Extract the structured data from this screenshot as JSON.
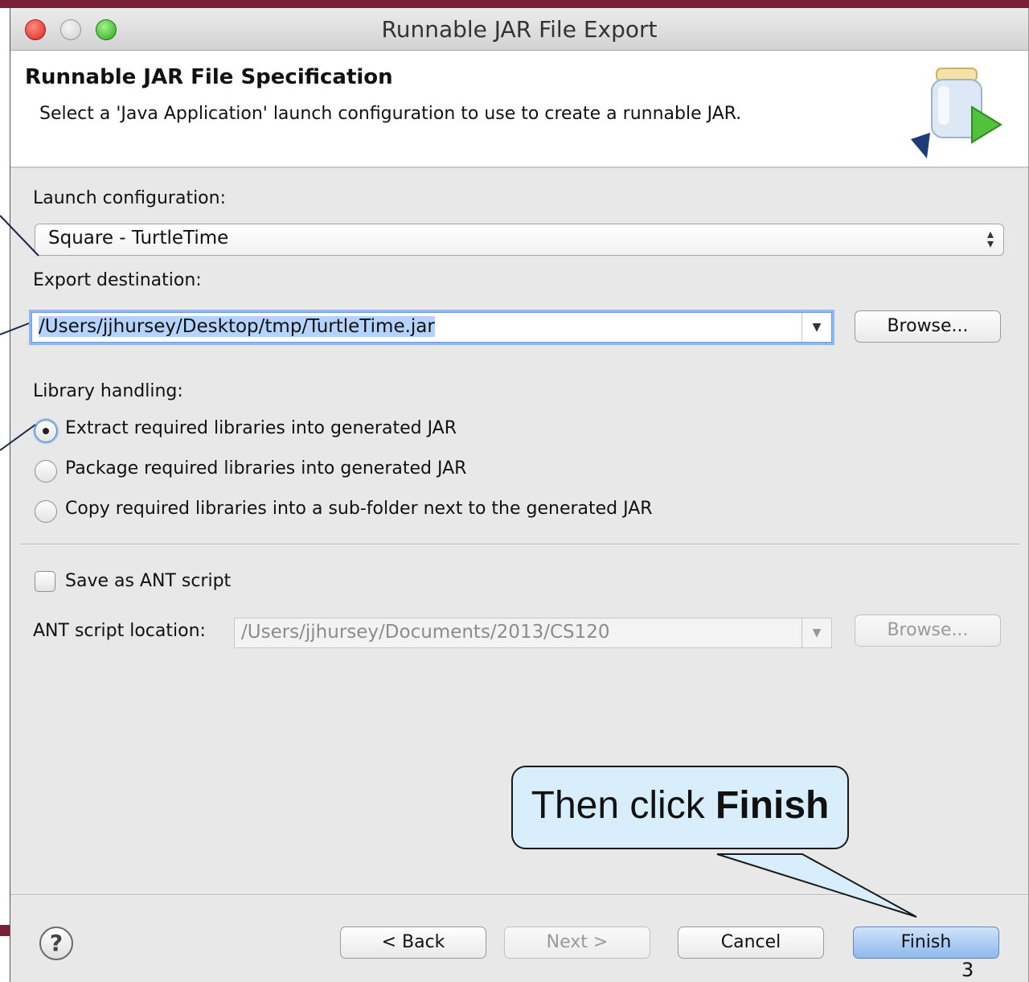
{
  "window": {
    "title": "Runnable JAR File Export"
  },
  "header": {
    "title": "Runnable JAR File Specification",
    "description": "Select a 'Java Application' launch configuration to use to create a runnable JAR."
  },
  "launch": {
    "label": "Launch configuration:",
    "selected": "Square - TurtleTime"
  },
  "export": {
    "label": "Export destination:",
    "value": "/Users/jjhursey/Desktop/tmp/TurtleTime.jar",
    "browse": "Browse..."
  },
  "library": {
    "label": "Library handling:",
    "options": [
      {
        "label": "Extract required libraries into generated JAR",
        "checked": true
      },
      {
        "label": "Package required libraries into generated JAR",
        "checked": false
      },
      {
        "label": "Copy required libraries into a sub-folder next to the generated JAR",
        "checked": false
      }
    ]
  },
  "ant": {
    "save_label": "Save as ANT script",
    "location_label": "ANT script location:",
    "location_value": "/Users/jjhursey/Documents/2013/CS120",
    "browse": "Browse..."
  },
  "buttons": {
    "back": "< Back",
    "next": "Next >",
    "cancel": "Cancel",
    "finish": "Finish"
  },
  "callout": {
    "prefix": "Then click ",
    "bold": "Finish"
  },
  "slide": {
    "page_number": "3"
  }
}
